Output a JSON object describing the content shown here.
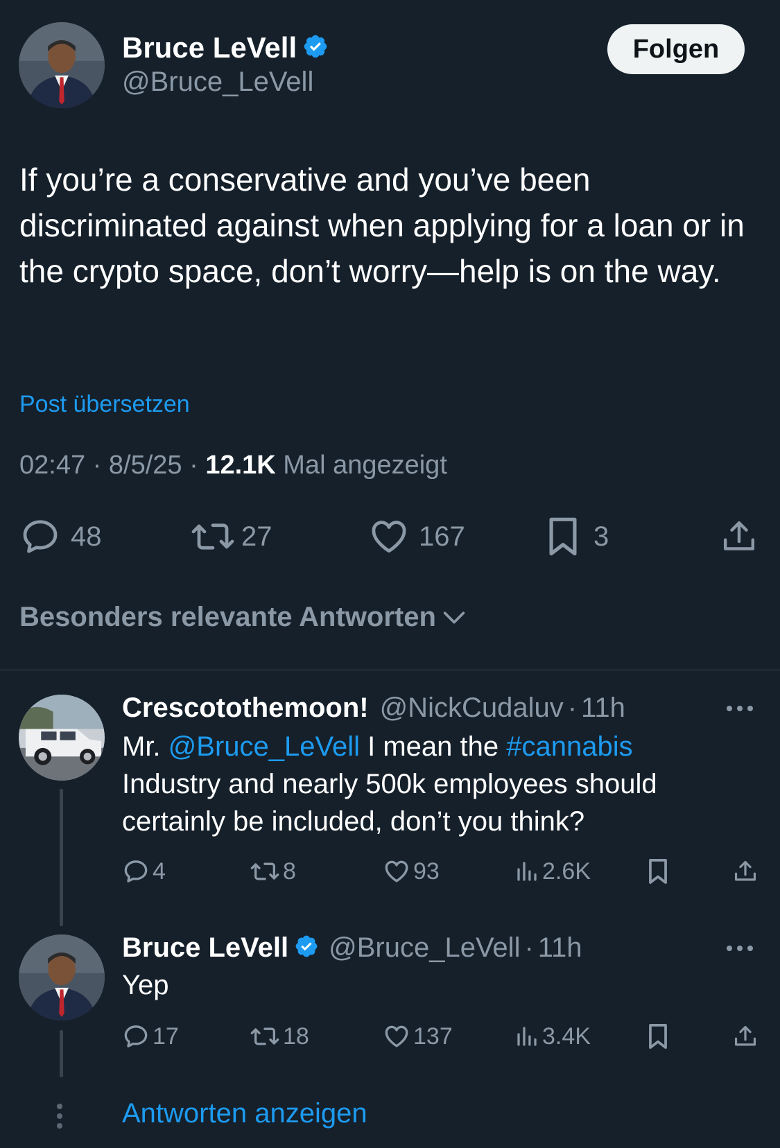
{
  "post": {
    "author_name": "Bruce LeVell",
    "author_handle": "@Bruce_LeVell",
    "follow_label": "Folgen",
    "text": "If you’re a conservative and you’ve been discriminated against when applying for a loan or in the crypto space, don’t worry—help is on the way.",
    "translate_label": "Post übersetzen",
    "time": "02:47",
    "date": "8/5/25",
    "views_count": "12.1K",
    "views_label": "Mal angezeigt",
    "actions": {
      "replies": "48",
      "reposts": "27",
      "likes": "167",
      "bookmarks": "3"
    }
  },
  "replies_sort_label": "Besonders relevante Antworten",
  "replies": [
    {
      "author_name": "Crescotothemoon!",
      "author_handle": "@NickCudaluv",
      "time_ago": "11h",
      "text_prefix": "Mr. ",
      "mention": "@Bruce_LeVell",
      "text_middle": " I mean the ",
      "hashtag": "#cannabis",
      "text_line2": "Industry and nearly 500k employees should",
      "text_line3": "certainly be included, don’t you think?",
      "stats": {
        "replies": "4",
        "reposts": "8",
        "likes": "93",
        "views": "2.6K"
      }
    },
    {
      "author_name": "Bruce LeVell",
      "author_handle": "@Bruce_LeVell",
      "time_ago": "11h",
      "text": "Yep",
      "stats": {
        "replies": "17",
        "reposts": "18",
        "likes": "137",
        "views": "3.4K"
      }
    }
  ],
  "show_replies_label": "Antworten anzeigen",
  "separator": "·",
  "colors": {
    "background": "#15202b",
    "accent": "#1d9bf0",
    "muted": "#8b98a5",
    "verified": "#1d9bf0"
  }
}
